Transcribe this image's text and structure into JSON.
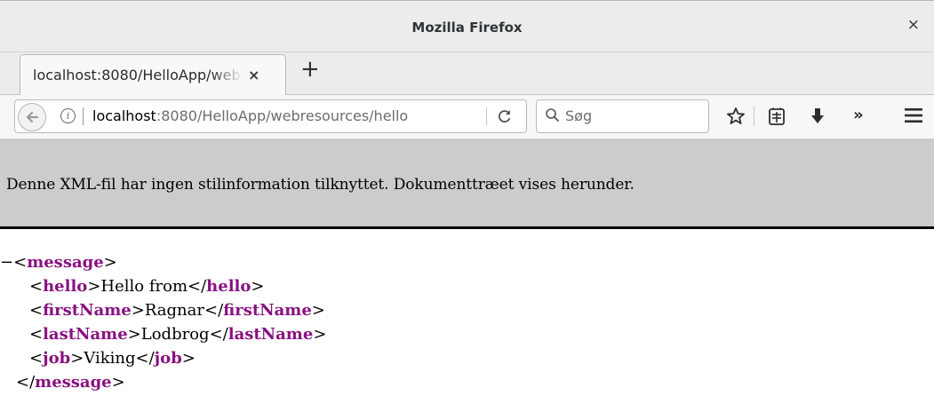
{
  "window": {
    "title": "Mozilla Firefox",
    "close_glyph": "×"
  },
  "tabs": [
    {
      "label": "localhost:8080/HelloApp/webresources/hello",
      "close_glyph": "×"
    }
  ],
  "new_tab_glyph": "+",
  "navbar": {
    "url_host": "localhost",
    "url_rest": ":8080/HelloApp/webresources/hello",
    "search_placeholder": "Søg",
    "overflow_glyph": "»",
    "icons": [
      "back-icon",
      "info-icon",
      "reload-icon",
      "search-icon",
      "bookmark-star-icon",
      "reader-list-icon",
      "download-icon",
      "overflow-icon",
      "hamburger-menu-icon"
    ]
  },
  "xml_banner": {
    "text": "Denne XML-fil har ingen stilinformation tilknyttet. Dokumenttræet vises herunder."
  },
  "xml_tree": {
    "collapse_glyph": "−",
    "root": {
      "tag": "message",
      "children": [
        {
          "tag": "hello",
          "text": "Hello from"
        },
        {
          "tag": "firstName",
          "text": "Ragnar"
        },
        {
          "tag": "lastName",
          "text": "Lodbrog"
        },
        {
          "tag": "job",
          "text": "Viking"
        }
      ]
    }
  },
  "colors": {
    "tag_color": "#881280",
    "banner_bg": "#cccccc",
    "chrome_bg": "#ececec"
  }
}
